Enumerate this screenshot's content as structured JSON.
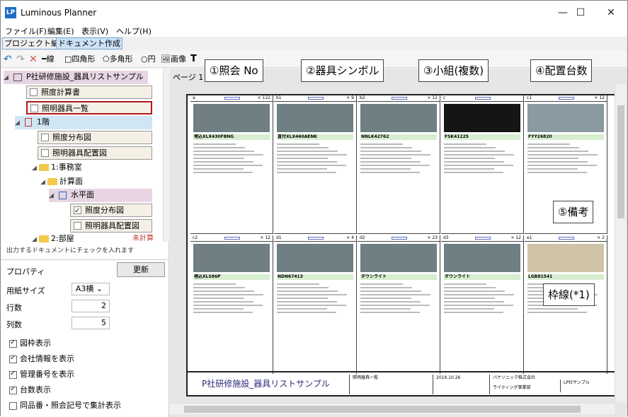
{
  "app": {
    "logo": "LP",
    "title": "Luminous Planner"
  },
  "window_buttons": {
    "minimize": "—",
    "maximize": "☐",
    "close": "✕"
  },
  "menu": [
    "ファイル(F)",
    "編集(E)",
    "表示(V)",
    "ヘルプ(H)"
  ],
  "modes": [
    "プロジェクト編集",
    "ドキュメント作成"
  ],
  "toolbar": {
    "line": "線",
    "rect": "四角形",
    "polygon": "多角形",
    "circle": "円",
    "image": "画像"
  },
  "tree": {
    "root": "P社研修施設_器具リストサンプル",
    "items": [
      {
        "label": "照度計算書",
        "checked": false
      },
      {
        "label": "照明器具一覧",
        "checked": false
      },
      {
        "label": "1階"
      },
      {
        "label": "照度分布図",
        "checked": false
      },
      {
        "label": "照明器具配置図",
        "checked": false
      },
      {
        "label": "1:事務室"
      },
      {
        "label": "計算面"
      },
      {
        "label": "水平面"
      },
      {
        "label": "照度分布図",
        "checked": true
      },
      {
        "label": "照明器具配置図",
        "checked": false
      },
      {
        "label": "2:部屋"
      }
    ],
    "uncalculated": "未計算",
    "hint": "出力するドキュメントにチェックを入れます"
  },
  "properties": {
    "title": "プロパティ",
    "update": "更新",
    "paper_size_label": "用紙サイズ",
    "paper_size": "A3横",
    "rows_label": "行数",
    "rows": "2",
    "cols_label": "列数",
    "cols": "5",
    "checks": [
      {
        "label": "図枠表示",
        "checked": true
      },
      {
        "label": "会社情報を表示",
        "checked": true
      },
      {
        "label": "管理番号を表示",
        "checked": true
      },
      {
        "label": "台数表示",
        "checked": true
      },
      {
        "label": "同品番・照会記号で集計表示",
        "checked": false
      }
    ]
  },
  "main": {
    "page_label": "ページ 1",
    "cells": [
      {
        "code": "a",
        "count": "× 122",
        "model": "埋込XLX430FBNG",
        "photo": "#6f7f84"
      },
      {
        "code": "b1",
        "count": "× 9",
        "model": "直付XLX460AENK",
        "photo": "#6f7f84"
      },
      {
        "code": "b2",
        "count": "× 12",
        "model": "NNLK42762",
        "photo": "#6f7f84"
      },
      {
        "code": "c",
        "count": "",
        "model": "FSK41225",
        "photo": "#151515"
      },
      {
        "code": "c1",
        "count": "× 12",
        "model": "FYY26820",
        "photo": "#8a9aa0"
      },
      {
        "code": "c2",
        "count": "× 12",
        "model": "埋込XLS86P",
        "photo": "#6f7f84"
      },
      {
        "code": "d1",
        "count": "× 4",
        "model": "NDN67413",
        "photo": "#6f7f84"
      },
      {
        "code": "d2",
        "count": "× 23",
        "model": "ダウンライト",
        "photo": "#6f7f84"
      },
      {
        "code": "d3",
        "count": "× 12",
        "model": "ダウンライト",
        "photo": "#6f7f84"
      },
      {
        "code": "e1",
        "count": "× 2",
        "model": "LGB81541",
        "photo": "#cfc3a8"
      }
    ],
    "footer": {
      "title": "P社研修施設_器具リストサンプル",
      "doc": "照明器具一覧",
      "date": "2016.10.26",
      "company": "パナソニック株式会社",
      "dept": "ライティング事業部",
      "code": "LP社サンプル"
    }
  },
  "annotations": {
    "c1": "①照会 No",
    "c2": "②器具シンボル",
    "c3": "③小組(複数)",
    "c4": "④配置台数",
    "c5": "⑤備考",
    "c6": "枠線(*1)"
  }
}
